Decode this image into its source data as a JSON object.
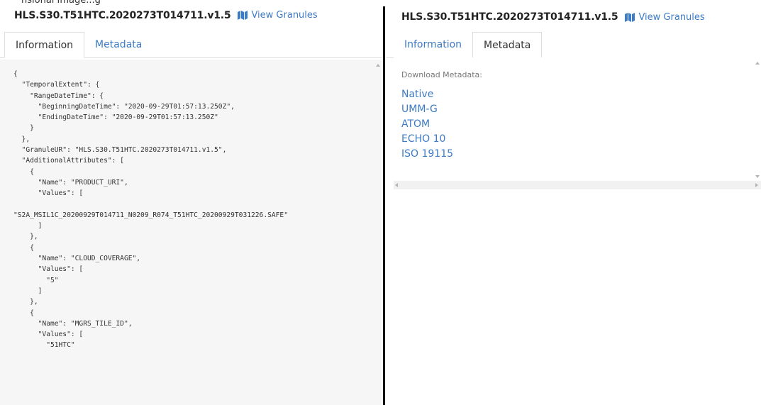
{
  "left": {
    "top_partial_text": "nsional Image...g",
    "title": "HLS.S30.T51HTC.2020273T014711.v1.5",
    "view_granules_label": "View Granules",
    "tabs": [
      {
        "label": "Information",
        "active": true
      },
      {
        "label": "Metadata",
        "active": false
      }
    ],
    "json_text": "{\n  \"TemporalExtent\": {\n    \"RangeDateTime\": {\n      \"BeginningDateTime\": \"2020-09-29T01:57:13.250Z\",\n      \"EndingDateTime\": \"2020-09-29T01:57:13.250Z\"\n    }\n  },\n  \"GranuleUR\": \"HLS.S30.T51HTC.2020273T014711.v1.5\",\n  \"AdditionalAttributes\": [\n    {\n      \"Name\": \"PRODUCT_URI\",\n      \"Values\": [\n\n\"S2A_MSIL1C_20200929T014711_N0209_R074_T51HTC_20200929T031226.SAFE\"\n      ]\n    },\n    {\n      \"Name\": \"CLOUD_COVERAGE\",\n      \"Values\": [\n        \"5\"\n      ]\n    },\n    {\n      \"Name\": \"MGRS_TILE_ID\",\n      \"Values\": [\n        \"51HTC\""
  },
  "right": {
    "title": "HLS.S30.T51HTC.2020273T014711.v1.5",
    "view_granules_label": "View Granules",
    "tabs": [
      {
        "label": "Information",
        "active": false
      },
      {
        "label": "Metadata",
        "active": true
      }
    ],
    "download_label": "Download Metadata:",
    "links": [
      "Native",
      "UMM-G",
      "ATOM",
      "ECHO 10",
      "ISO 19115"
    ]
  },
  "colors": {
    "link": "#3c7bc5",
    "json_background": "#f6f6f6",
    "divider": "#111111"
  },
  "icons": {
    "view_granules": "map-icon"
  }
}
